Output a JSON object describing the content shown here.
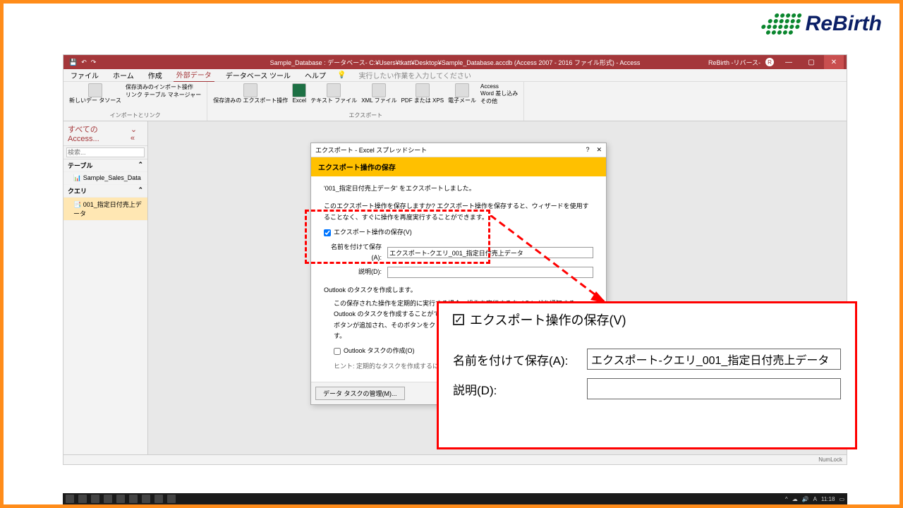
{
  "logo_text": "ReBirth",
  "titlebar": {
    "title": "Sample_Database : データベース- C:¥Users¥tkatt¥Desktop¥Sample_Database.accdb (Access 2007 - 2016 ファイル形式) - Access",
    "right_label": "ReBirth -リバース-"
  },
  "menu": {
    "items": [
      "ファイル",
      "ホーム",
      "作成",
      "外部データ",
      "データベース ツール",
      "ヘルプ"
    ],
    "active": 3,
    "tellme": "実行したい作業を入力してください"
  },
  "ribbon": {
    "g1": {
      "btn1": "新しいデー\nタソース",
      "l1": "保存済みのインポート操作",
      "l2": "リンク テーブル マネージャー",
      "label": "インポートとリンク"
    },
    "g2": {
      "b1": "保存済みの\nエクスポート操作",
      "b2": "Excel",
      "b3": "テキスト\nファイル",
      "b4": "XML\nファイル",
      "b5": "PDF または\nXPS",
      "b6": "電子メール",
      "b7": "Access",
      "b8": "Word 差し込み",
      "b9": "その他",
      "label": "エクスポート"
    }
  },
  "nav": {
    "head": "すべての Access...",
    "search": "検索...",
    "cat1": "テーブル",
    "item1": "Sample_Sales_Data",
    "cat2": "クエリ",
    "item2": "001_指定日付売上データ"
  },
  "dialog": {
    "title": "エクスポート - Excel スプレッドシート",
    "banner": "エクスポート操作の保存",
    "msg1": "'001_指定日付売上データ' をエクスポートしました。",
    "msg2": "このエクスポート操作を保存しますか? エクスポート操作を保存すると、ウィザードを使用することなく、すぐに操作を再度実行することができます。",
    "chk1": "エクスポート操作の保存(V)",
    "lbl_name": "名前を付けて保存(A):",
    "val_name": "エクスポート-クエリ_001_指定日付売上データ",
    "lbl_desc": "説明(D):",
    "outlook_head": "Outlook のタスクを作成します。",
    "outlook_msg": "この保存された操作を定期的に実行する場合、操作を実行するタイミングを通知する Outlook のタスクを作成することができます。Outlook のタスクには [エクスポートの実行] ボタンが追加され、そのボタンをクリックすると Access でエクスポート操作が実行されます。",
    "chk2": "Outlook タスクの作成(O)",
    "hint": "ヒント: 定期的なタスクを作成するには、Outlook でタスク",
    "foot_btn": "データ タスクの管理(M)..."
  },
  "zoom": {
    "chk": "エクスポート操作の保存(V)",
    "name_lbl": "名前を付けて保存(A):",
    "name_val": "エクスポート-クエリ_001_指定日付売上データ",
    "desc_lbl": "説明(D):"
  },
  "status": "NumLock",
  "tray_time": "11:18"
}
